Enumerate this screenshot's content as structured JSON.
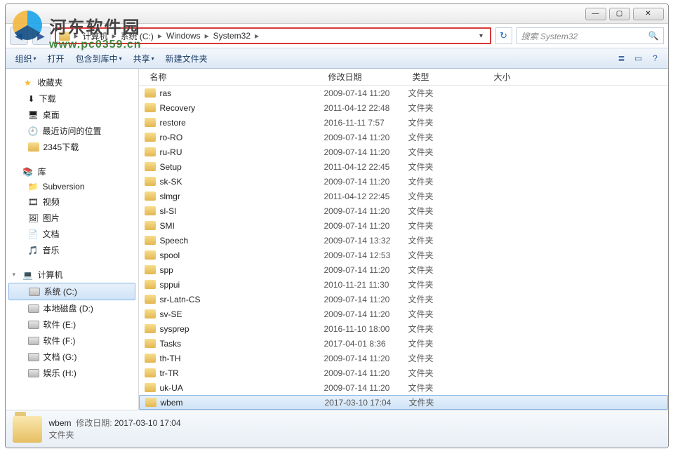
{
  "watermark": {
    "site_name": "河东软件园",
    "site_url": "www.pc0359.cn"
  },
  "titlebar": {
    "min": "—",
    "max": "▢",
    "close": "✕"
  },
  "nav": {
    "back": "◀",
    "fwd": "▶",
    "crumbs": [
      "计算机",
      "系统 (C:)",
      "Windows",
      "System32"
    ],
    "sep": "▸",
    "dropdown": "▾",
    "refresh": "↻"
  },
  "search": {
    "placeholder": "搜索 System32",
    "icon": "🔍"
  },
  "toolbar": {
    "organize": "组织",
    "open": "打开",
    "include": "包含到库中",
    "share": "共享",
    "newfolder": "新建文件夹",
    "dd": "▾",
    "view": "≣",
    "preview": "▭",
    "help": "?"
  },
  "sidebar": {
    "fav": {
      "label": "收藏夹",
      "items": [
        "下载",
        "桌面",
        "最近访问的位置",
        "2345下载"
      ]
    },
    "lib": {
      "label": "库",
      "items": [
        "Subversion",
        "视频",
        "图片",
        "文档",
        "音乐"
      ]
    },
    "comp": {
      "label": "计算机",
      "items": [
        "系统 (C:)",
        "本地磁盘 (D:)",
        "软件 (E:)",
        "软件 (F:)",
        "文档 (G:)",
        "娱乐 (H:)"
      ],
      "sel_index": 0
    }
  },
  "columns": {
    "name": "名称",
    "date": "修改日期",
    "type": "类型",
    "size": "大小"
  },
  "rows": [
    {
      "name": "ras",
      "date": "2009-07-14 11:20",
      "type": "文件夹"
    },
    {
      "name": "Recovery",
      "date": "2011-04-12 22:48",
      "type": "文件夹"
    },
    {
      "name": "restore",
      "date": "2016-11-11 7:57",
      "type": "文件夹"
    },
    {
      "name": "ro-RO",
      "date": "2009-07-14 11:20",
      "type": "文件夹"
    },
    {
      "name": "ru-RU",
      "date": "2009-07-14 11:20",
      "type": "文件夹"
    },
    {
      "name": "Setup",
      "date": "2011-04-12 22:45",
      "type": "文件夹"
    },
    {
      "name": "sk-SK",
      "date": "2009-07-14 11:20",
      "type": "文件夹"
    },
    {
      "name": "slmgr",
      "date": "2011-04-12 22:45",
      "type": "文件夹"
    },
    {
      "name": "sl-SI",
      "date": "2009-07-14 11:20",
      "type": "文件夹"
    },
    {
      "name": "SMI",
      "date": "2009-07-14 11:20",
      "type": "文件夹"
    },
    {
      "name": "Speech",
      "date": "2009-07-14 13:32",
      "type": "文件夹"
    },
    {
      "name": "spool",
      "date": "2009-07-14 12:53",
      "type": "文件夹"
    },
    {
      "name": "spp",
      "date": "2009-07-14 11:20",
      "type": "文件夹"
    },
    {
      "name": "sppui",
      "date": "2010-11-21 11:30",
      "type": "文件夹"
    },
    {
      "name": "sr-Latn-CS",
      "date": "2009-07-14 11:20",
      "type": "文件夹"
    },
    {
      "name": "sv-SE",
      "date": "2009-07-14 11:20",
      "type": "文件夹"
    },
    {
      "name": "sysprep",
      "date": "2016-11-10 18:00",
      "type": "文件夹"
    },
    {
      "name": "Tasks",
      "date": "2017-04-01 8:36",
      "type": "文件夹"
    },
    {
      "name": "th-TH",
      "date": "2009-07-14 11:20",
      "type": "文件夹"
    },
    {
      "name": "tr-TR",
      "date": "2009-07-14 11:20",
      "type": "文件夹"
    },
    {
      "name": "uk-UA",
      "date": "2009-07-14 11:20",
      "type": "文件夹"
    },
    {
      "name": "wbem",
      "date": "2017-03-10 17:04",
      "type": "文件夹",
      "sel": true
    }
  ],
  "details": {
    "name": "wbem",
    "date_label": "修改日期:",
    "date": "2017-03-10 17:04",
    "type": "文件夹"
  }
}
